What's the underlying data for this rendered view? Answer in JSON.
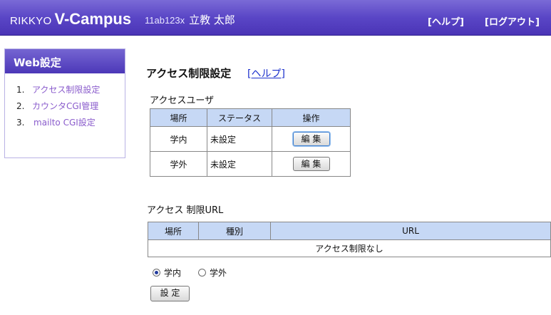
{
  "header": {
    "logo_prefix": "RIKKYO",
    "logo_main": "V-Campus",
    "user_id": "11ab123x",
    "user_name": "立教 太郎",
    "help_link": "[ヘルプ]",
    "logout_link": "[ログアウト]"
  },
  "sidebar": {
    "title": "Web設定",
    "items": [
      {
        "num": "1.",
        "label": "アクセス制限設定"
      },
      {
        "num": "2.",
        "label": "カウンタCGI管理"
      },
      {
        "num": "3.",
        "label": "mailto CGI設定"
      }
    ]
  },
  "main": {
    "title": "アクセス制限設定",
    "help_link": "[ヘルプ]",
    "access_user": {
      "heading": "アクセスユーザ",
      "columns": [
        "場所",
        "ステータス",
        "操作"
      ],
      "rows": [
        {
          "location": "学内",
          "status": "未設定",
          "action": "編 集"
        },
        {
          "location": "学外",
          "status": "未設定",
          "action": "編 集"
        }
      ]
    },
    "access_url": {
      "heading": "アクセス 制限URL",
      "columns": [
        "場所",
        "種別",
        "URL"
      ],
      "empty_text": "アクセス制限なし"
    },
    "radio": {
      "options": [
        "学内",
        "学外"
      ],
      "selected": "学内"
    },
    "submit_label": "設 定"
  }
}
